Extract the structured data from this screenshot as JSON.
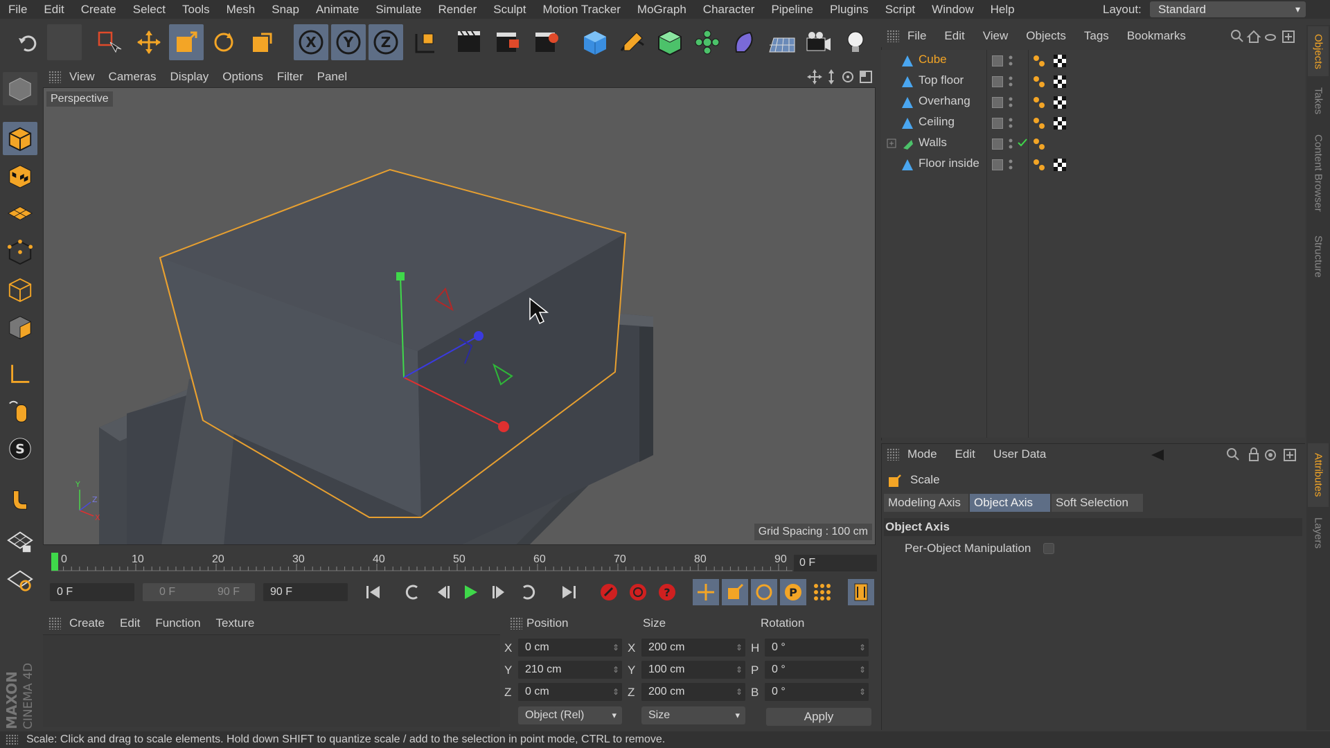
{
  "menubar": {
    "items": [
      "File",
      "Edit",
      "Create",
      "Select",
      "Tools",
      "Mesh",
      "Snap",
      "Animate",
      "Simulate",
      "Render",
      "Sculpt",
      "Motion Tracker",
      "MoGraph",
      "Character",
      "Pipeline",
      "Plugins",
      "Script",
      "Window",
      "Help"
    ],
    "layout_label": "Layout:",
    "layout_value": "Standard"
  },
  "toolbar": {
    "icons": [
      "undo-icon",
      "live-selection-icon",
      "move-icon",
      "scale-icon",
      "rotate-icon",
      "recent-tool-icon",
      "x-axis-lock-icon",
      "y-axis-lock-icon",
      "z-axis-lock-icon",
      "coordinate-system-icon",
      "render-view-icon",
      "render-picture-viewer-icon",
      "render-settings-icon",
      "cube-primitive-icon",
      "pen-spline-icon",
      "subdivision-icon",
      "cloner-icon",
      "deformer-icon",
      "floor-icon",
      "camera-icon",
      "light-icon"
    ],
    "axis_x": "X",
    "axis_y": "Y",
    "axis_z": "Z"
  },
  "viewport": {
    "menu": [
      "View",
      "Cameras",
      "Display",
      "Options",
      "Filter",
      "Panel"
    ],
    "label": "Perspective",
    "grid_spacing": "Grid Spacing : 100 cm"
  },
  "timeline": {
    "ticks": [
      "0",
      "10",
      "20",
      "30",
      "40",
      "50",
      "60",
      "70",
      "80",
      "90"
    ],
    "current_frame": "0 F"
  },
  "transport": {
    "start_frame": "0 F",
    "range_start": "0 F",
    "range_end": "90 F",
    "end_frame": "90 F"
  },
  "material_manager": {
    "menu": [
      "Create",
      "Edit",
      "Function",
      "Texture"
    ]
  },
  "coordinates": {
    "headers": {
      "position": "Position",
      "size": "Size",
      "rotation": "Rotation"
    },
    "position": {
      "x_label": "X",
      "y_label": "Y",
      "z_label": "Z",
      "x": "0 cm",
      "y": "210 cm",
      "z": "0 cm"
    },
    "size": {
      "x_label": "X",
      "y_label": "Y",
      "z_label": "Z",
      "x": "200 cm",
      "y": "100 cm",
      "z": "200 cm"
    },
    "rotation": {
      "h_label": "H",
      "p_label": "P",
      "b_label": "B",
      "h": "0 °",
      "p": "0 °",
      "b": "0 °"
    },
    "mode_dropdown": "Object (Rel)",
    "size_dropdown": "Size",
    "apply": "Apply"
  },
  "object_manager": {
    "menu": [
      "File",
      "Edit",
      "View",
      "Objects",
      "Tags",
      "Bookmarks"
    ],
    "objects": [
      {
        "name": "Cube",
        "selected": true,
        "has_texture": true
      },
      {
        "name": "Top floor",
        "selected": false,
        "has_texture": true
      },
      {
        "name": "Overhang",
        "selected": false,
        "has_texture": true
      },
      {
        "name": "Ceiling",
        "selected": false,
        "has_texture": true
      },
      {
        "name": "Walls",
        "selected": false,
        "has_texture": false
      },
      {
        "name": "Floor inside",
        "selected": false,
        "has_texture": true
      }
    ]
  },
  "attributes": {
    "menu": [
      "Mode",
      "Edit",
      "User Data"
    ],
    "title": "Scale",
    "tabs": [
      "Modeling Axis",
      "Object Axis",
      "Soft Selection"
    ],
    "active_tab": "Object Axis",
    "section": "Object Axis",
    "per_object_label": "Per-Object Manipulation",
    "per_object_checked": false
  },
  "right_tabs": [
    "Objects",
    "Takes",
    "Content Browser",
    "Structure",
    "Attributes",
    "Layers"
  ],
  "status": "Scale: Click and drag to scale elements. Hold down SHIFT to quantize scale / add to the selection in point mode, CTRL to remove.",
  "logo": {
    "line1": "MAXON",
    "line2": "CINEMA 4D"
  },
  "colors": {
    "accent": "#f3a526",
    "active_tool": "#5e6e86",
    "viewport_bg": "#5b5b5b",
    "selection_outline": "#e8a030"
  }
}
